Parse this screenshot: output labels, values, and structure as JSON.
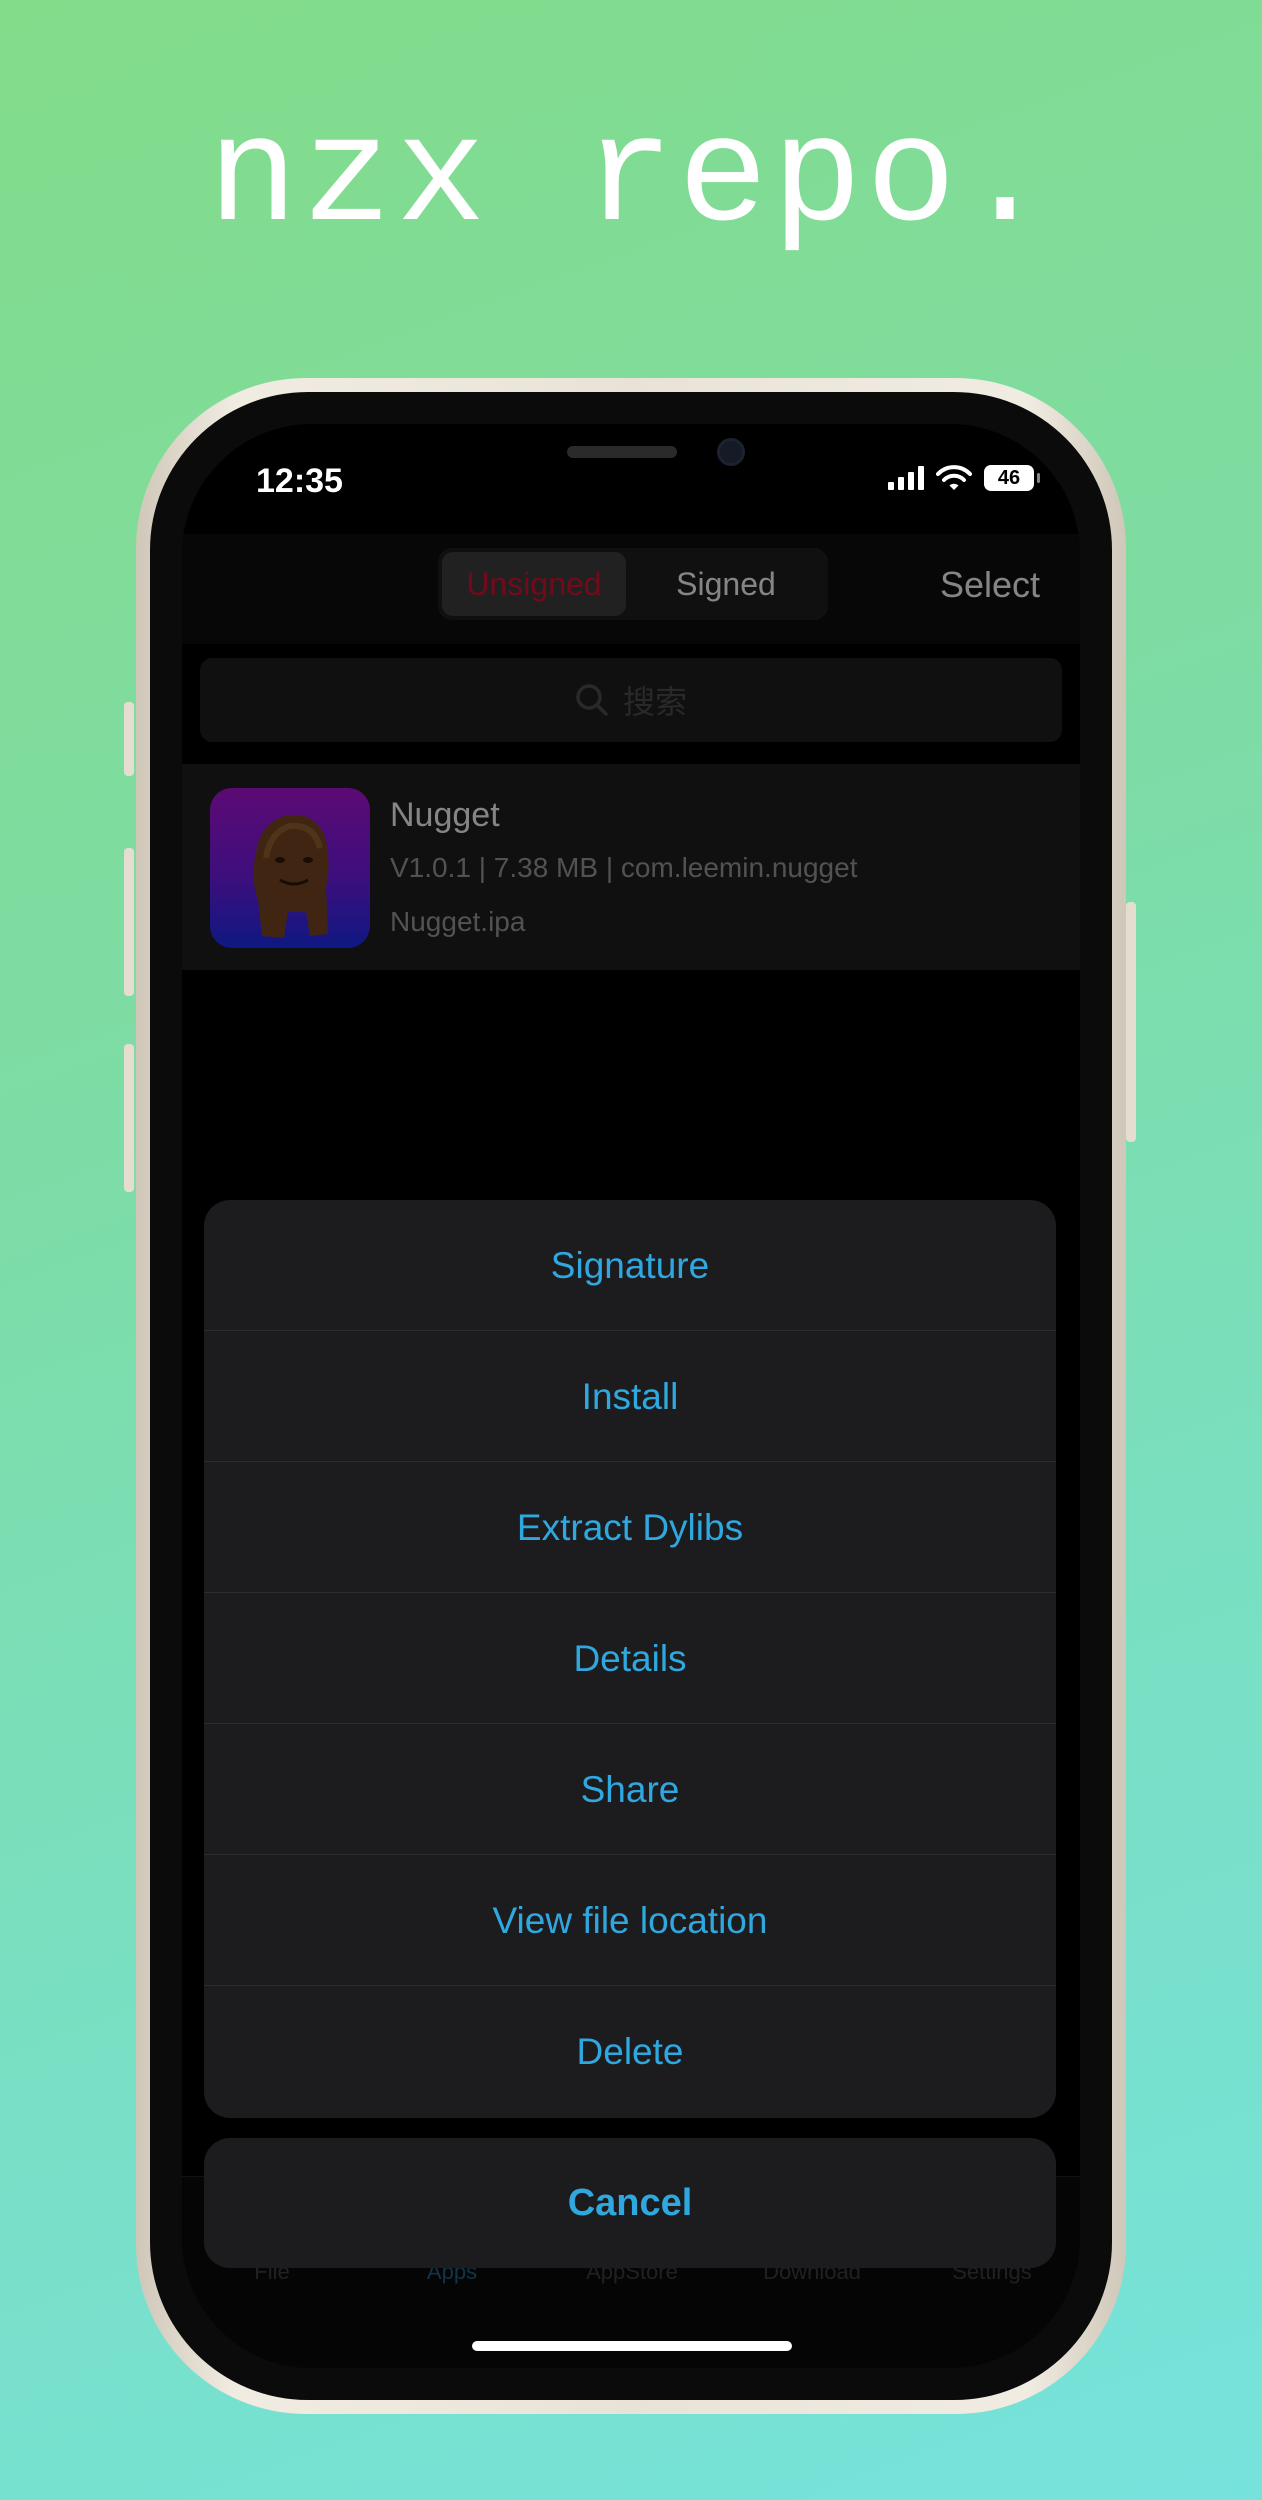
{
  "headline": "nzx repo.",
  "status_bar": {
    "time": "12:35",
    "battery": "46"
  },
  "navbar": {
    "segments": [
      {
        "label": "Unsigned",
        "selected": true
      },
      {
        "label": "Signed",
        "selected": false
      }
    ],
    "select_label": "Select"
  },
  "search": {
    "placeholder": "搜索"
  },
  "app": {
    "name": "Nugget",
    "meta": "V1.0.1 | 7.38 MB | com.leemin.nugget",
    "file": "Nugget.ipa"
  },
  "action_sheet": {
    "items": [
      {
        "label": "Signature"
      },
      {
        "label": "Install"
      },
      {
        "label": "Extract Dylibs"
      },
      {
        "label": "Details"
      },
      {
        "label": "Share"
      },
      {
        "label": "View file location"
      },
      {
        "label": "Delete"
      }
    ],
    "cancel_label": "Cancel"
  },
  "tabbar": {
    "tabs": [
      {
        "label": "File"
      },
      {
        "label": "Apps"
      },
      {
        "label": "AppStore"
      },
      {
        "label": "Download"
      },
      {
        "label": "Settings"
      }
    ]
  },
  "colors": {
    "accent": "#2fa8e0",
    "unsigned_red": "#c8102e",
    "sheet_bg": "#1c1c1e",
    "background_top": "#82dc8a",
    "background_bottom": "#76e2dc"
  },
  "icons": [
    "search-icon",
    "wifi-icon",
    "signal-icon",
    "battery-icon",
    "nugget-app-icon"
  ]
}
